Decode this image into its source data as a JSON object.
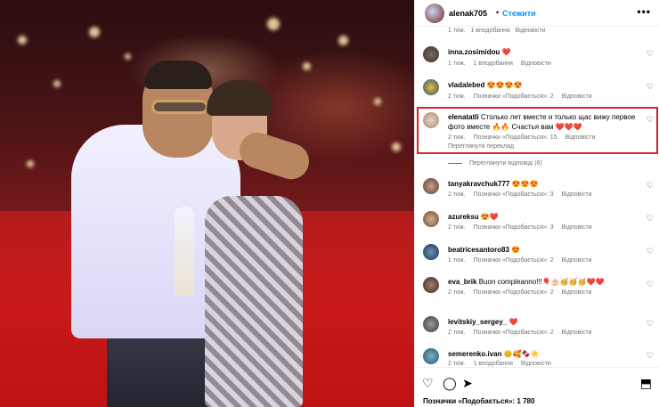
{
  "post": {
    "username": "alenak705",
    "follow_label": "Стежити",
    "dot": "•",
    "more": "•••",
    "likes_text": "Позначки «Подобається»: 1 780"
  },
  "top_meta": {
    "age": "1 тиж.",
    "likes": "1 вподобання",
    "reply": "Відповісти"
  },
  "comments": [
    {
      "user": "inna.zosimidou",
      "text": "",
      "emoji": "❤️",
      "age": "1 тиж.",
      "likes": "1 вподобання",
      "reply": "Відповісти"
    },
    {
      "user": "vladalebed",
      "text": "",
      "emoji": "😍😍😍😍",
      "age": "2 тиж.",
      "likes": "Позначки «Подобається»: 2",
      "reply": "Відповісти"
    },
    {
      "user": "elenatatli",
      "text": "Столько лет вместе и только щас вижу первое фото вместе",
      "emoji": "🔥🔥 Счастья вам ❤️❤️❤️",
      "age": "2 тиж.",
      "likes": "Позначки «Подобається»: 15",
      "reply": "Відповісти",
      "translate": "Переглянути переклад"
    },
    {
      "user": "tanyakravchuk777",
      "text": "",
      "emoji": "😍😍😍",
      "age": "2 тиж.",
      "likes": "Позначки «Подобається»: 3",
      "reply": "Відповісти"
    },
    {
      "user": "azureksu",
      "text": "",
      "emoji": "😍❤️",
      "age": "2 тиж.",
      "likes": "Позначки «Подобається»: 3",
      "reply": "Відповісти"
    },
    {
      "user": "beatricesantoro83",
      "text": "",
      "emoji": "😍",
      "age": "1 тиж.",
      "likes": "Позначки «Подобається»: 2",
      "reply": "Відповісти"
    },
    {
      "user": "eva_brik",
      "text": "Buon compleanno!!!",
      "emoji": "🎈🎂🥳🥳🥳❤️❤️",
      "age": "2 тиж.",
      "likes": "Позначки «Подобається»: 2",
      "reply": "Відповісти"
    },
    {
      "user": "levitskiy_sergey_",
      "text": "",
      "emoji": "❤️",
      "age": "2 тиж.",
      "likes": "Позначки «Подобається»: 2",
      "reply": "Відповісти"
    },
    {
      "user": "semerenko.ivan",
      "text": "",
      "emoji": "😊🥰🍫☀️",
      "age": "2 тиж.",
      "likes": "1 вподобання",
      "reply": "Відповісти"
    }
  ],
  "view_replies": "Переглянути відповіді (6)",
  "colors": {
    "accent": "#0095f6",
    "highlight": "#d9232d",
    "meta": "#737373"
  }
}
